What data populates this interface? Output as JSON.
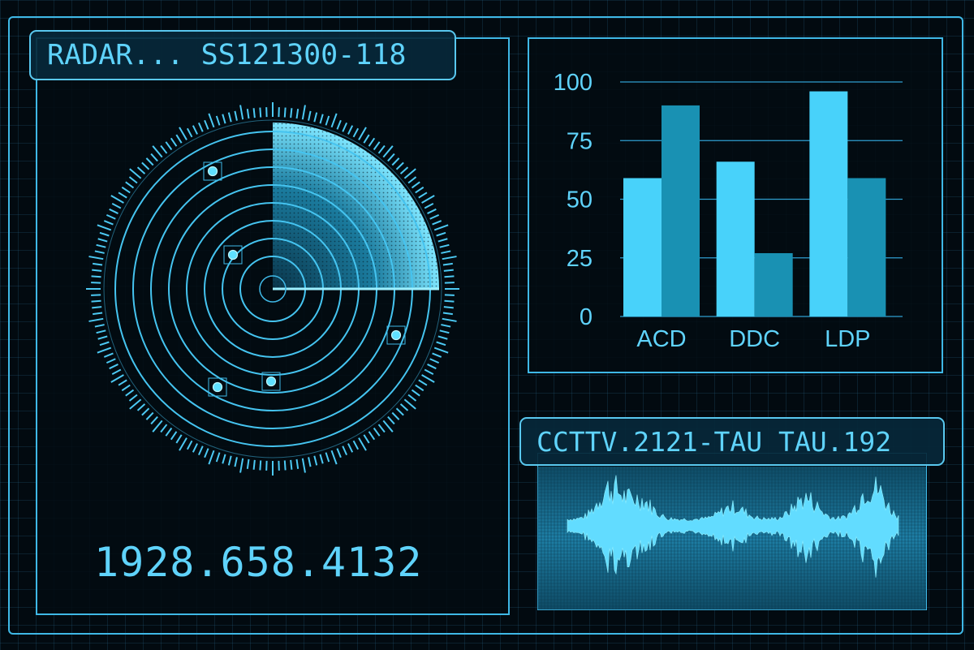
{
  "radar": {
    "title": "RADAR... SS121300-118",
    "readout": "1928.658.4132"
  },
  "cctv": {
    "title": "CCTTV.2121-TAU TAU.192"
  },
  "colors": {
    "accent": "#3fb8e6",
    "text": "#5fd3fb",
    "bar_light": "#48d2fa",
    "bar_dark": "#1991b3",
    "background": "#020a10"
  },
  "icons": {
    "radar": "radar-sweep-icon",
    "blip": "target-blip-icon",
    "waveform": "audio-waveform-icon"
  },
  "chart_data": {
    "type": "bar",
    "categories": [
      "ACD",
      "DDC",
      "LDP"
    ],
    "series": [
      {
        "values": [
          59,
          66,
          96
        ]
      },
      {
        "values": [
          90,
          27,
          59
        ]
      }
    ],
    "ylim": [
      0,
      100
    ],
    "yticks": [
      "0",
      "25",
      "50",
      "75",
      "100"
    ],
    "grid": true,
    "legend": "none",
    "xlabel": "",
    "ylabel": ""
  }
}
